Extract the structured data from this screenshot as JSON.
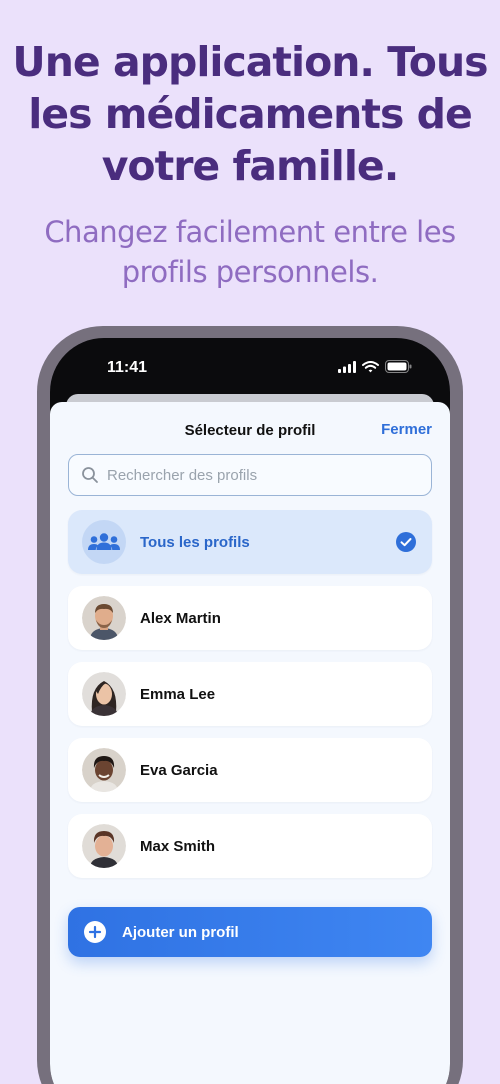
{
  "marketing": {
    "headline": "Une application. Tous les médicaments de votre famille.",
    "subhead": "Changez facilement entre les profils personnels."
  },
  "status_bar": {
    "time": "11:41"
  },
  "sheet": {
    "title": "Sélecteur de profil",
    "close_label": "Fermer",
    "search_placeholder": "Rechercher des profils"
  },
  "profiles": [
    {
      "name": "Tous les profils",
      "selected": true,
      "icon": "people-group-icon"
    },
    {
      "name": "Alex Martin",
      "selected": false
    },
    {
      "name": "Emma Lee",
      "selected": false
    },
    {
      "name": "Eva Garcia",
      "selected": false
    },
    {
      "name": "Max Smith",
      "selected": false
    }
  ],
  "add_profile": {
    "label": "Ajouter un profil",
    "icon": "plus-circle-icon"
  },
  "colors": {
    "background": "#ebe1fb",
    "headline": "#4a2d7e",
    "subhead": "#8f6cc1",
    "accent": "#2f72e3"
  }
}
